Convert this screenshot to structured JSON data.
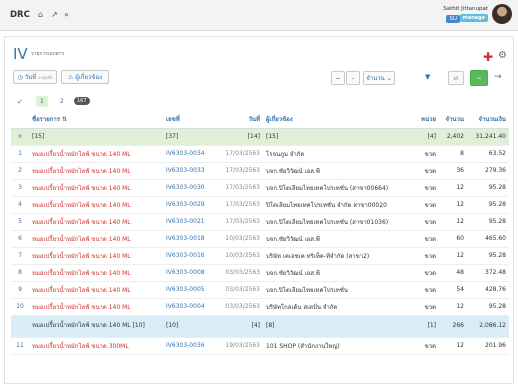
{
  "topbar": {
    "brand": "DRC",
    "icons": [
      "home-icon",
      "external-link-icon",
      "fast-forward-icon"
    ],
    "user_name": "Sathit Jittanupat",
    "user_role": "SU",
    "user_badge": "manage"
  },
  "page": {
    "title": "IV",
    "subtitle": "รายการเอกสาร"
  },
  "toolbar": {
    "date_filter_label": "วันที่",
    "date_filter_sub": "ล่าสุดทั้ง",
    "related_label": "ผู้เกี่ยวข้อง",
    "minus_label": "−",
    "dash_label": "-",
    "qty_dropdown_label": "จำนวน",
    "chevron": "⌄",
    "filter_icon": "▼",
    "excel_icon": "⇄",
    "collapse_label": "−",
    "arrow_label": "→"
  },
  "tabs": {
    "check_icon": "✓",
    "page1": "1",
    "page2": "2",
    "count": "167"
  },
  "table": {
    "headers": [
      "",
      "ชื่อรายการ ⇅",
      "เลขที่",
      "วันที่",
      "ผู้เกี่ยวข้อง",
      "หน่วย",
      "จำนวน",
      "จำนวนเงิน"
    ],
    "summary": {
      "close": "×",
      "name": "[15]",
      "doc": "[37]",
      "date": "[14]",
      "party": "[15]",
      "unit": "[4]",
      "qty": "2,402",
      "amount": "31,241.40"
    },
    "rows": [
      {
        "no": "1",
        "name": "หมอเปรี้ยวน้ำหมักไลฟ์ ขนาด 140 ML",
        "doc": "IV6303-0034",
        "date": "17/03/2563",
        "party": "โรจนภูม จำกัด",
        "unit": "ขวด",
        "qty": "8",
        "amount": "63.52"
      },
      {
        "no": "2",
        "name": "หมอเปรี้ยวน้ำหมักไลฟ์ ขนาด 140 ML",
        "doc": "IV6303-0033",
        "date": "17/03/2563",
        "party": "บจก.ซัยวิวัฒน์ เอส.พี",
        "unit": "ขวด",
        "qty": "36",
        "amount": "279.36"
      },
      {
        "no": "3",
        "name": "หมอเปรี้ยวน้ำหมักไลฟ์ ขนาด 140 ML",
        "doc": "IV6303-0030",
        "date": "17/03/2563",
        "party": "บจก.ปิโตเลียมไทยเทคโปรเทชั่น (สาขา00664)",
        "unit": "ขวด",
        "qty": "12",
        "amount": "95.28"
      },
      {
        "no": "4",
        "name": "หมอเปรี้ยวน้ำหมักไลฟ์ ขนาด 140 ML",
        "doc": "IV6303-0029",
        "date": "17/03/2563",
        "party": "ปิโตเลียมไทยเทคโปรเทชั่น จำกัด สาขา00020",
        "unit": "ขวด",
        "qty": "12",
        "amount": "95.28"
      },
      {
        "no": "5",
        "name": "หมอเปรี้ยวน้ำหมักไลฟ์ ขนาด 140 ML",
        "doc": "IV6303-0021",
        "date": "17/03/2563",
        "party": "บจก.ปิโตเลียมไทยเทคโปรเทชั่น (สาขา01036)",
        "unit": "ขวด",
        "qty": "12",
        "amount": "95.28"
      },
      {
        "no": "6",
        "name": "หมอเปรี้ยวน้ำหมักไลฟ์ ขนาด 140 ML",
        "doc": "IV6303-0018",
        "date": "10/03/2563",
        "party": "บจก.ซัยวิวัฒน์ เอส.พี",
        "unit": "ขวด",
        "qty": "60",
        "amount": "465.60"
      },
      {
        "no": "7",
        "name": "หมอเปรี้ยวน้ำหมักไลฟ์ ขนาด 140 ML",
        "doc": "IV6303-0016",
        "date": "10/03/2563",
        "party": "บริษัท เคเอชเค ทริเท็ค-ทีจำกัด (สาขา2)",
        "unit": "ขวด",
        "qty": "12",
        "amount": "95.28"
      },
      {
        "no": "8",
        "name": "หมอเปรี้ยวน้ำหมักไลฟ์ ขนาด 140 ML",
        "doc": "IV6303-0008",
        "date": "03/03/2563",
        "party": "บจก.ซัยวิวัฒน์ เอส.พี",
        "unit": "ขวด",
        "qty": "48",
        "amount": "372.48"
      },
      {
        "no": "9",
        "name": "หมอเปรี้ยวน้ำหมักไลฟ์ ขนาด 140 ML",
        "doc": "IV6303-0005",
        "date": "03/03/2563",
        "party": "บจก.ปิโตเลียมไทยเทคโปรเทชั่น",
        "unit": "ขวด",
        "qty": "54",
        "amount": "428.76"
      },
      {
        "no": "10",
        "name": "หมอเปรี้ยวน้ำหมักไลฟ์ ขนาด 140 ML",
        "doc": "IV6303-0004",
        "date": "03/03/2563",
        "party": "บริษัทโกลเด้น สเตปั่น จำกัด",
        "unit": "ขวด",
        "qty": "12",
        "amount": "95.28"
      }
    ],
    "group": {
      "name": "หมอเปรี้ยวน้ำหมักไลฟ์ ขนาด 140 ML [10]",
      "doc": "[10]",
      "date": "[4]",
      "party": "[8]",
      "unit": "[1]",
      "qty": "266",
      "amount": "2,086.12"
    },
    "last_row": {
      "no": "11",
      "name": "หมอเปรี้ยวน้ำหมักไลฟ์ ขนาด 300ML",
      "doc": "IV6303-0036",
      "date": "19/03/2563",
      "party": "101 SHOP (สำนักงานใหญ่)",
      "unit": "ขวด",
      "qty": "12",
      "amount": "201.96"
    }
  },
  "colors": {
    "accent": "#3a73a8",
    "danger": "#c9302c",
    "success": "#5cb85c",
    "summary_bg": "#dff0d8",
    "group_bg": "#d9edf7"
  }
}
